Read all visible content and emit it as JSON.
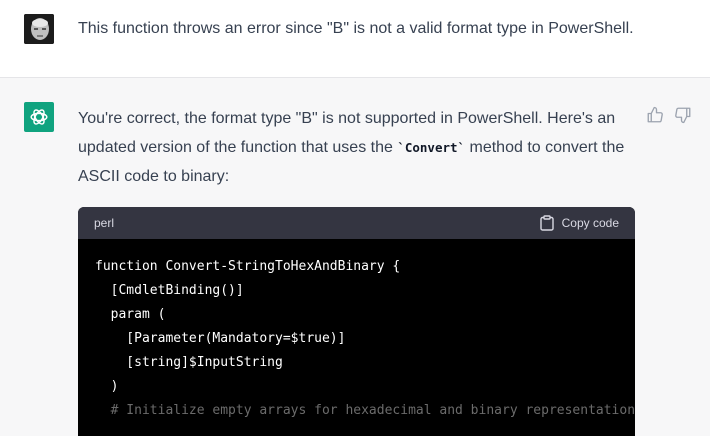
{
  "user_message": {
    "text": "This function throws an error since \"B\" is not a valid format type in PowerShell."
  },
  "assistant_message": {
    "text_part1": "You're correct, the format type \"B\" is not supported in PowerShell. Here's an updated version of the function that uses the ",
    "inline_code": "`Convert`",
    "text_part2": " method to convert the ASCII code to binary:",
    "feedback": {
      "thumb_up_icon": "thumbs-up-icon",
      "thumb_down_icon": "thumbs-down-icon"
    }
  },
  "code_block": {
    "language": "perl",
    "copy_label": "Copy code",
    "lines": [
      "function Convert-StringToHexAndBinary {",
      "  [CmdletBinding()]",
      "  param (",
      "    [Parameter(Mandatory=$true)]",
      "    [string]$InputString",
      "  )",
      "",
      "  # Initialize empty arrays for hexadecimal and binary representation"
    ]
  },
  "colors": {
    "brand_green": "#10a37f",
    "code_bg": "#000000",
    "code_header_bg": "#343541"
  }
}
